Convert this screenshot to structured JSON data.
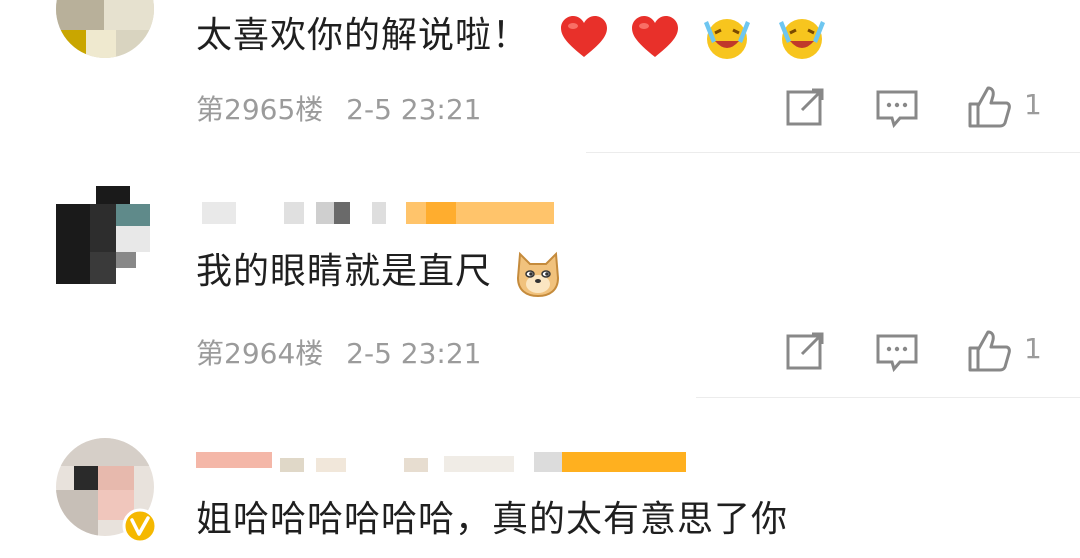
{
  "comments": [
    {
      "text": "太喜欢你的解说啦！",
      "emojis": [
        "red-heart",
        "red-heart",
        "laughing-crying-face",
        "laughing-crying-face"
      ],
      "floor": "第2965楼",
      "datetime": "2-5 23:21",
      "likes": "1"
    },
    {
      "text": "我的眼睛就是直尺",
      "emojis": [
        "doge-face"
      ],
      "floor": "第2964楼",
      "datetime": "2-5 23:21",
      "likes": "1"
    },
    {
      "text": "姐哈哈哈哈哈哈，真的太有意思了你",
      "emojis": [],
      "verified": true
    }
  ],
  "colors": {
    "text": "#1f1f1f",
    "meta": "#9b9b9b",
    "divider": "#ececec",
    "verified_badge": "#f5b800",
    "heart": "#e8302a"
  }
}
